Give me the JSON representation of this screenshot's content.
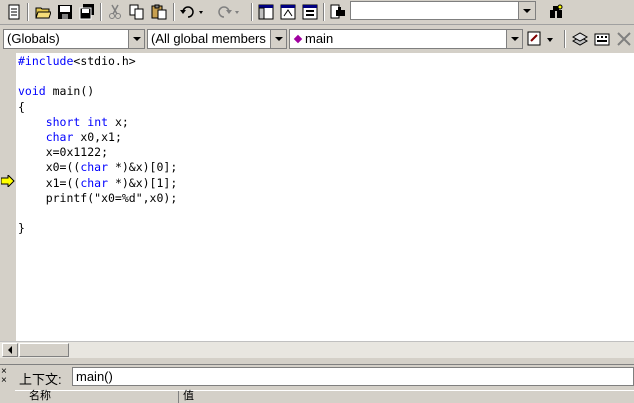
{
  "toolbar": {
    "find_value": "",
    "icons": [
      "new-file-icon",
      "open-folder-icon",
      "save-icon",
      "save-all-icon",
      "cut-icon",
      "copy-icon",
      "paste-icon",
      "undo-icon",
      "redo-icon",
      "workspace-icon",
      "output-icon",
      "window-list-icon",
      "find-in-files-icon",
      "find-icon"
    ]
  },
  "wizardbar": {
    "class_combo": "(Globals)",
    "filter_combo": "(All global members",
    "members_combo": "main"
  },
  "code": {
    "lines": [
      {
        "parts": [
          {
            "t": "#include",
            "c": "pp"
          },
          {
            "t": "<stdio.h>",
            "c": ""
          }
        ]
      },
      {
        "parts": []
      },
      {
        "parts": [
          {
            "t": "void",
            "c": "kw"
          },
          {
            "t": " main()",
            "c": ""
          }
        ]
      },
      {
        "parts": [
          {
            "t": "{",
            "c": ""
          }
        ]
      },
      {
        "parts": [
          {
            "t": "    ",
            "c": ""
          },
          {
            "t": "short",
            "c": "kw"
          },
          {
            "t": " ",
            "c": ""
          },
          {
            "t": "int",
            "c": "kw"
          },
          {
            "t": " x;",
            "c": ""
          }
        ]
      },
      {
        "parts": [
          {
            "t": "    ",
            "c": ""
          },
          {
            "t": "char",
            "c": "kw"
          },
          {
            "t": " x0,x1;",
            "c": ""
          }
        ]
      },
      {
        "parts": [
          {
            "t": "    x=0x1122;",
            "c": ""
          }
        ]
      },
      {
        "parts": [
          {
            "t": "    x0=((",
            "c": ""
          },
          {
            "t": "char",
            "c": "kw"
          },
          {
            "t": " *)&x)[0];",
            "c": ""
          }
        ]
      },
      {
        "parts": [
          {
            "t": "    x1=((",
            "c": ""
          },
          {
            "t": "char",
            "c": "kw"
          },
          {
            "t": " *)&x)[1];",
            "c": ""
          }
        ]
      },
      {
        "parts": [
          {
            "t": "    printf(\"x0=%d\",x0);",
            "c": ""
          }
        ]
      },
      {
        "parts": []
      },
      {
        "parts": [
          {
            "t": "}",
            "c": ""
          }
        ]
      }
    ]
  },
  "bottom": {
    "context_label": "上下文:",
    "context_value": "main()",
    "col_name": "名称",
    "col_value": "值"
  }
}
